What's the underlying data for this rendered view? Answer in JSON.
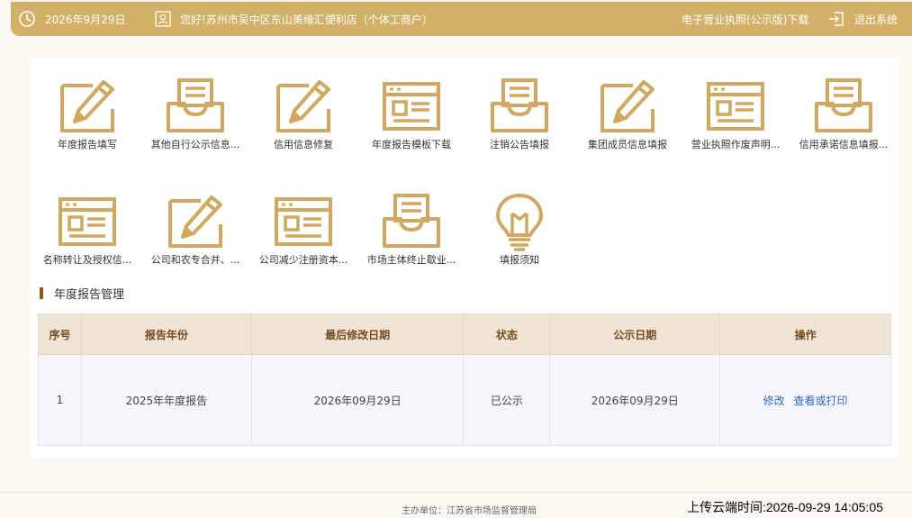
{
  "header": {
    "date": "2026年9月29日",
    "greeting": "您好!苏州市吴中区东山美缘汇便利店（个体工商户）",
    "license_download": "电子营业执照(公示版)下载",
    "logout": "退出系统"
  },
  "tiles": [
    {
      "label": "年度报告填写",
      "icon": "pencil-form-icon"
    },
    {
      "label": "其他自行公示信息...",
      "icon": "inbox-document-icon"
    },
    {
      "label": "信用信息修复",
      "icon": "pencil-form-icon"
    },
    {
      "label": "年度报告模板下载",
      "icon": "document-window-icon"
    },
    {
      "label": "注销公告填报",
      "icon": "inbox-document-icon"
    },
    {
      "label": "集团成员信息填报",
      "icon": "pencil-form-icon"
    },
    {
      "label": "营业执照作废声明...",
      "icon": "document-window-icon"
    },
    {
      "label": "信用承诺信息填报...",
      "icon": "inbox-document-icon"
    },
    {
      "label": "名称转让及授权信...",
      "icon": "document-window-icon"
    },
    {
      "label": "公司和农专合并、...",
      "icon": "pencil-form-icon"
    },
    {
      "label": "公司减少注册资本...",
      "icon": "document-window-icon"
    },
    {
      "label": "市场主体终止歇业...",
      "icon": "inbox-document-icon"
    },
    {
      "label": "填报须知",
      "icon": "lightbulb-icon"
    }
  ],
  "section": {
    "title": "年度报告管理"
  },
  "table": {
    "headers": [
      "序号",
      "报告年份",
      "最后修改日期",
      "状态",
      "公示日期",
      "操作"
    ],
    "rows": [
      {
        "index": "1",
        "year": "2025年年度报告",
        "modified": "2026年09月29日",
        "status": "已公示",
        "published": "2026年09月29日",
        "actions": [
          "修改",
          "查看或打印"
        ]
      }
    ]
  },
  "footer": {
    "host": "主办单位：江苏省市场监督管理局",
    "upload_time": "上传云端时间:2026-09-29 14:05:05"
  },
  "colors": {
    "brand": "#d2b067",
    "icon": "#d1a85d",
    "link": "#2f68c9",
    "header_text": "#7a4a1c"
  }
}
